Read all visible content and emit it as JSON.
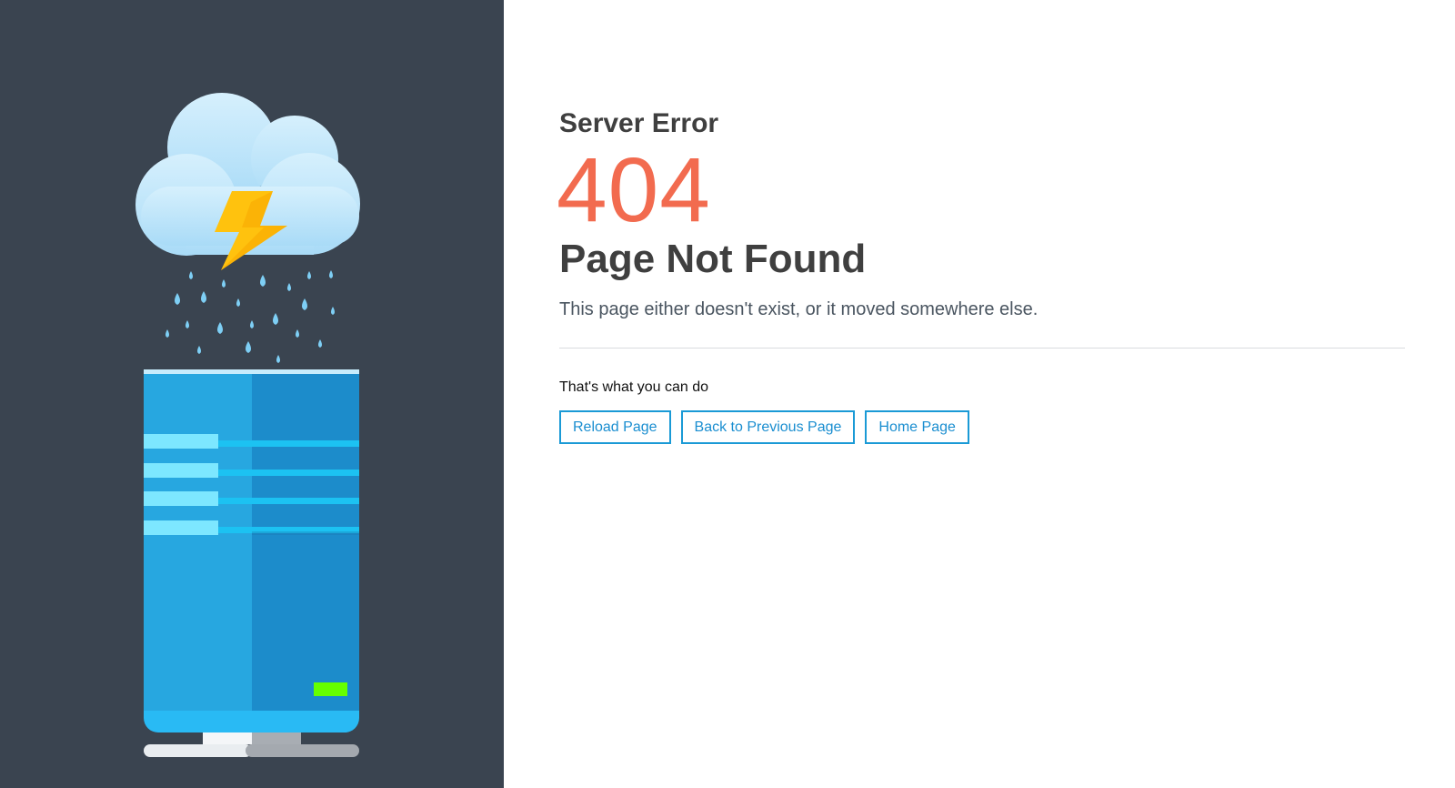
{
  "error": {
    "subtitle": "Server Error",
    "code": "404",
    "title": "Page Not Found",
    "description": "This page either doesn't exist, or it moved somewhere else."
  },
  "actions": {
    "label": "That's what you can do",
    "buttons": {
      "reload": "Reload Page",
      "back": "Back to Previous Page",
      "home": "Home Page"
    }
  },
  "illustration": {
    "icon": "storm-cloud-server-icon",
    "colors": {
      "panel_background": "#3a4450",
      "cloud": "#bfe6fb",
      "lightning": "#ffc20e",
      "rain": "#7ecff5",
      "server_left": "#27a7e0",
      "server_right": "#1c8ccb",
      "server_stripe": "#7de7ff",
      "status_led": "#66ff00"
    }
  },
  "colors": {
    "code": "#f26b4f",
    "accent": "#1a9ad6",
    "text": "#3f3f3f"
  }
}
